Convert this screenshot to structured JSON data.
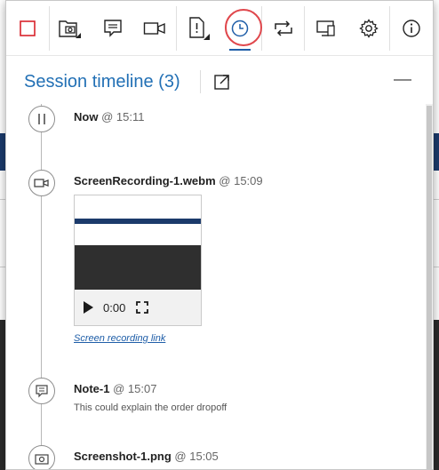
{
  "toolbar": {
    "buttons": [
      {
        "name": "stop-recording-button",
        "icon": "square-icon"
      },
      {
        "name": "screenshot-button",
        "icon": "camera-folder-icon"
      },
      {
        "name": "note-button",
        "icon": "note-icon"
      },
      {
        "name": "record-video-button",
        "icon": "video-camera-icon"
      },
      {
        "name": "issue-button",
        "icon": "document-alert-icon"
      },
      {
        "name": "timeline-button",
        "icon": "clock-icon",
        "active": true
      },
      {
        "name": "sync-button",
        "icon": "repeat-icon"
      },
      {
        "name": "device-button",
        "icon": "device-icon"
      },
      {
        "name": "settings-button",
        "icon": "gear-icon"
      },
      {
        "name": "info-button",
        "icon": "info-icon"
      }
    ],
    "active_color": "#e0474c",
    "accent": "#1f5ea8"
  },
  "header": {
    "title": "Session timeline (3)"
  },
  "timeline": {
    "items": [
      {
        "kind": "now",
        "label": "Now",
        "time": "@ 15:11"
      },
      {
        "kind": "recording",
        "label": "ScreenRecording-1.webm",
        "time": "@ 15:09",
        "player_time": "0:00",
        "link": "Screen recording link"
      },
      {
        "kind": "note",
        "label": "Note-1",
        "time": "@ 15:07",
        "text": "This could explain the order dropoff"
      },
      {
        "kind": "screenshot",
        "label": "Screenshot-1.png",
        "time": "@ 15:05"
      }
    ]
  }
}
